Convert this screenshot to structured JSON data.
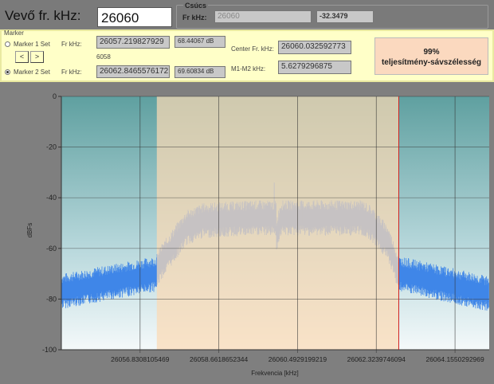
{
  "header": {
    "receiver_label": "Vevő fr. kHz:",
    "receiver_value": "26060",
    "peak": {
      "title": "Csúcs",
      "fr_label": "Fr kHz:",
      "fr_value": "26060",
      "level_value": "-32.3479"
    }
  },
  "marker": {
    "title": "Marker",
    "m1": {
      "label": "Marker 1 Set",
      "fr_label": "Fr kHz:",
      "fr_value": "26057.219827929",
      "db_value": "68.44067 dB",
      "selected": false
    },
    "m2": {
      "label": "Marker 2 Set",
      "fr_label": "Fr kHz:",
      "fr_value": "26062.8465576172",
      "db_value": "69.60834 dB",
      "selected": true
    },
    "prev": "<",
    "next": ">",
    "small_value": "6058",
    "center_label": "Center Fr. kHz:",
    "center_value": "26060.032592773",
    "diff_label": "M1-M2 kHz:",
    "diff_value": "5.6279296875"
  },
  "bandwidth_button": {
    "line1": "99%",
    "line2": "teljesítmény-sávszélesség"
  },
  "chart_data": {
    "type": "area",
    "xlabel": "Frekvencia [kHz]",
    "ylabel": "dBFs",
    "xlim": [
      26055.0,
      26064.95
    ],
    "ylim": [
      -100,
      0
    ],
    "yticks": [
      "0",
      "-20",
      "-40",
      "-60",
      "-80",
      "-100"
    ],
    "xticks": [
      {
        "v": 26056.8308105469,
        "label": "26056.8308105469"
      },
      {
        "v": 26058.6618652344,
        "label": "26058.6618652344"
      },
      {
        "v": 26060.4929199219,
        "label": "26060.4929199219"
      },
      {
        "v": 26062.3239746094,
        "label": "26062.3239746094"
      },
      {
        "v": 26064.1550292969,
        "label": "26064.1550292969"
      }
    ],
    "band": [
      26057.219827929,
      26062.8465576172
    ],
    "profile": [
      [
        26055.0,
        -77
      ],
      [
        26057.2,
        -70
      ],
      [
        26057.3,
        -66
      ],
      [
        26057.9,
        -52
      ],
      [
        26058.3,
        -49
      ],
      [
        26059.5,
        -48
      ],
      [
        26060.0,
        -48
      ],
      [
        26060.0,
        -55
      ],
      [
        26060.1,
        -48
      ],
      [
        26062.0,
        -48
      ],
      [
        26062.2,
        -50
      ],
      [
        26062.6,
        -58
      ],
      [
        26062.85,
        -70
      ],
      [
        26064.95,
        -78
      ]
    ],
    "spikes": [
      [
        26059.72,
        -45
      ],
      [
        26059.95,
        -34
      ],
      [
        26060.18,
        -43
      ],
      [
        26060.6,
        -44
      ],
      [
        26061.3,
        -44
      ]
    ],
    "colors": {
      "trace": "#3f86e8",
      "band": "#fbd9b4",
      "marker_line": "#d02020"
    }
  }
}
